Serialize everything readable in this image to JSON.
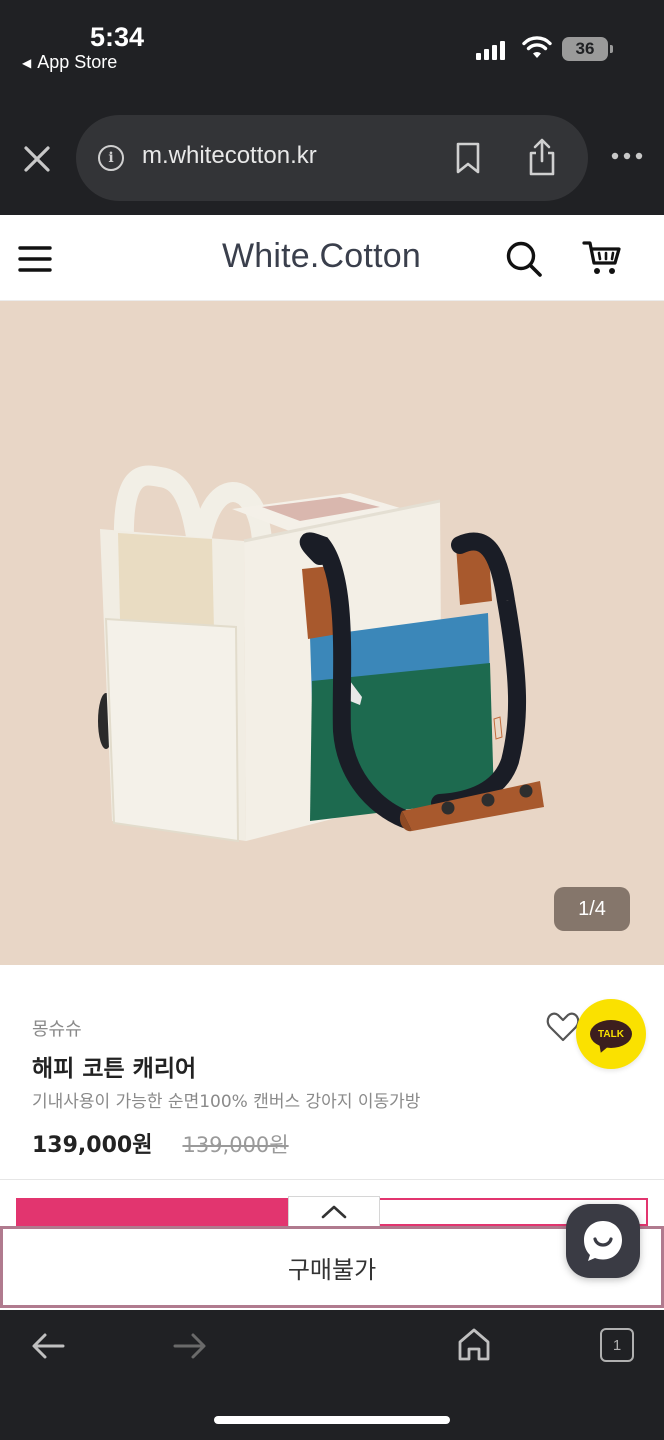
{
  "status_bar": {
    "time": "5:34",
    "back_app_label": "App Store",
    "battery_level": "36"
  },
  "browser": {
    "url": "m.whitecotton.kr",
    "icons": [
      "close-icon",
      "info-icon",
      "bookmark-icon",
      "share-icon",
      "more-icon"
    ]
  },
  "site_header": {
    "logo_text": "White.Cotton",
    "icons": [
      "menu-icon",
      "search-icon",
      "cart-icon"
    ]
  },
  "product_image": {
    "counter": "1/4",
    "background_color": "#e8d6c6"
  },
  "product": {
    "brand": "몽슈슈",
    "name": "해피 코튼 캐리어",
    "description": "기내사용이 가능한 순면100% 캔버스 강아지 이동가방",
    "price": "139,000원",
    "original_price": "139,000원"
  },
  "kakao": {
    "label": "TALK",
    "color": "#fae100"
  },
  "purchase": {
    "button_label": "구매불가",
    "accent_color": "#e2356f"
  },
  "bottom_toolbar": {
    "tab_count": "1",
    "icons": [
      "back-arrow-icon",
      "forward-arrow-icon",
      "home-icon",
      "tabs-icon"
    ]
  }
}
